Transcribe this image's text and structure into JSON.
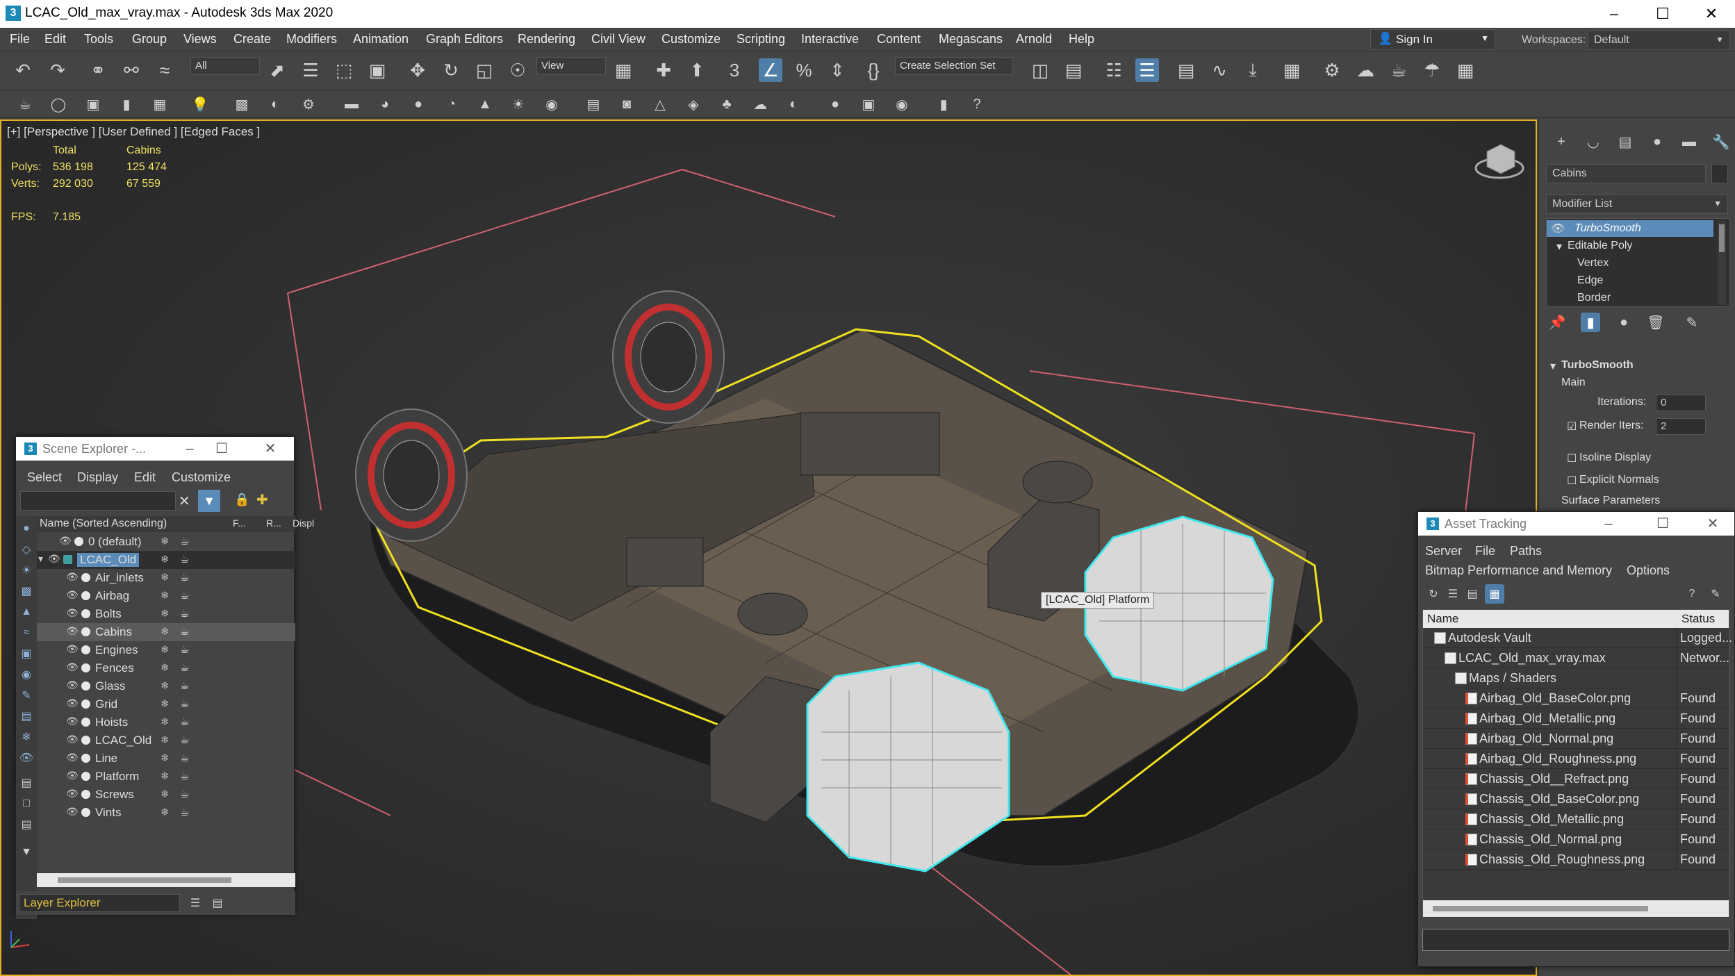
{
  "window": {
    "title": "LCAC_Old_max_vray.max - Autodesk 3ds Max 2020",
    "app_icon": "3"
  },
  "menu": [
    "File",
    "Edit",
    "Tools",
    "Group",
    "Views",
    "Create",
    "Modifiers",
    "Animation",
    "Graph Editors",
    "Rendering",
    "Civil View",
    "Customize",
    "Scripting",
    "Interactive",
    "Content",
    "Megascans",
    "Arnold",
    "Help"
  ],
  "signin": "Sign In",
  "workspaces": {
    "label": "Workspaces:",
    "value": "Default"
  },
  "toolbar": {
    "filter": "All",
    "refcoord": "View",
    "selection_set": "Create Selection Set"
  },
  "viewport": {
    "label": "[+] [Perspective ] [User Defined ] [Edged Faces ]",
    "stats": {
      "col_total": "Total",
      "col_sel": "Cabins",
      "polys_label": "Polys:",
      "polys_total": "536 198",
      "polys_sel": "125 474",
      "verts_label": "Verts:",
      "verts_total": "292 030",
      "verts_sel": "67 559",
      "fps_label": "FPS:",
      "fps": "7.185"
    },
    "tooltip": "[LCAC_Old] Platform"
  },
  "command_panel": {
    "object_name": "Cabins",
    "modifier_list": "Modifier List",
    "stack": [
      "TurboSmooth",
      "Editable Poly",
      "Vertex",
      "Edge",
      "Border"
    ],
    "rollout_title": "TurboSmooth",
    "main": "Main",
    "iterations_label": "Iterations:",
    "iterations": "0",
    "render_iters_label": "Render Iters:",
    "render_iters": "2",
    "isoline": "Isoline Display",
    "explicit": "Explicit Normals",
    "surface": "Surface Parameters"
  },
  "scene_explorer": {
    "title": "Scene Explorer -...",
    "menu": [
      "Select",
      "Display",
      "Edit",
      "Customize"
    ],
    "col_name": "Name (Sorted Ascending)",
    "col_f": "F...",
    "col_r": "R...",
    "col_d": "Displ",
    "rows": [
      {
        "name": "0 (default)",
        "indent": 1
      },
      {
        "name": "LCAC_Old",
        "indent": 0,
        "selected": true
      },
      {
        "name": "Air_inlets",
        "indent": 2
      },
      {
        "name": "Airbag",
        "indent": 2
      },
      {
        "name": "Bolts",
        "indent": 2
      },
      {
        "name": "Cabins",
        "indent": 2,
        "highlight": true
      },
      {
        "name": "Engines",
        "indent": 2
      },
      {
        "name": "Fences",
        "indent": 2
      },
      {
        "name": "Glass",
        "indent": 2
      },
      {
        "name": "Grid",
        "indent": 2
      },
      {
        "name": "Hoists",
        "indent": 2
      },
      {
        "name": "LCAC_Old",
        "indent": 2
      },
      {
        "name": "Line",
        "indent": 2
      },
      {
        "name": "Platform",
        "indent": 2
      },
      {
        "name": "Screws",
        "indent": 2
      },
      {
        "name": "Vints",
        "indent": 2
      }
    ],
    "footer": "Layer Explorer"
  },
  "asset_tracking": {
    "title": "Asset Tracking",
    "menu1": [
      "Server",
      "File",
      "Paths"
    ],
    "menu2": [
      "Bitmap Performance and Memory",
      "Options"
    ],
    "col_name": "Name",
    "col_status": "Status",
    "rows": [
      {
        "name": "Autodesk Vault",
        "status": "Logged...",
        "indent": 0,
        "type": "vault"
      },
      {
        "name": "LCAC_Old_max_vray.max",
        "status": "Networ...",
        "indent": 1,
        "type": "max"
      },
      {
        "name": "Maps / Shaders",
        "status": "",
        "indent": 2,
        "type": "folder"
      },
      {
        "name": "Airbag_Old_BaseColor.png",
        "status": "Found",
        "indent": 3,
        "type": "png"
      },
      {
        "name": "Airbag_Old_Metallic.png",
        "status": "Found",
        "indent": 3,
        "type": "png"
      },
      {
        "name": "Airbag_Old_Normal.png",
        "status": "Found",
        "indent": 3,
        "type": "png"
      },
      {
        "name": "Airbag_Old_Roughness.png",
        "status": "Found",
        "indent": 3,
        "type": "png"
      },
      {
        "name": "Chassis_Old__Refract.png",
        "status": "Found",
        "indent": 3,
        "type": "png"
      },
      {
        "name": "Chassis_Old_BaseColor.png",
        "status": "Found",
        "indent": 3,
        "type": "png"
      },
      {
        "name": "Chassis_Old_Metallic.png",
        "status": "Found",
        "indent": 3,
        "type": "png"
      },
      {
        "name": "Chassis_Old_Normal.png",
        "status": "Found",
        "indent": 3,
        "type": "png"
      },
      {
        "name": "Chassis_Old_Roughness.png",
        "status": "Found",
        "indent": 3,
        "type": "png"
      }
    ]
  },
  "colors": {
    "selection_yellow": "#f0e020",
    "cabin_cyan": "#40e8f0",
    "bbox_pink": "#d06070",
    "accent_blue": "#5b8bb8"
  }
}
